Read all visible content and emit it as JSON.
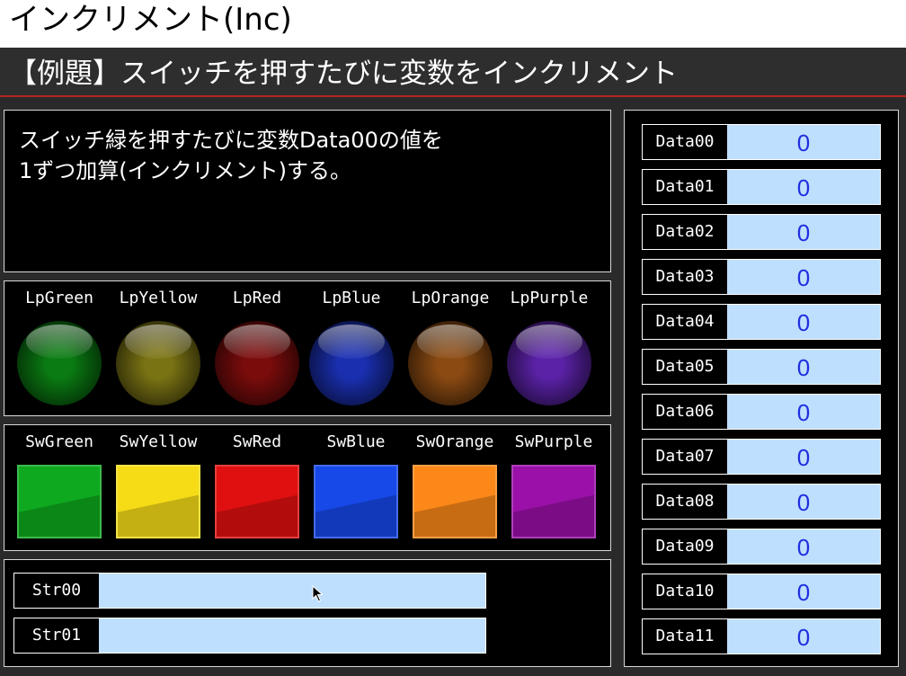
{
  "window": {
    "title": "インクリメント(Inc)"
  },
  "header": {
    "title": "【例題】スイッチを押すたびに変数をインクリメント"
  },
  "description": {
    "lines": [
      "スイッチ緑を押すたびに変数Data00の値を",
      "1ずつ加算(インクリメント)する。"
    ]
  },
  "lamps": [
    {
      "label": "LpGreen",
      "color": "#0a7a12"
    },
    {
      "label": "LpYellow",
      "color": "#7a7314"
    },
    {
      "label": "LpRed",
      "color": "#7a0c0c"
    },
    {
      "label": "LpBlue",
      "color": "#1a2fb0"
    },
    {
      "label": "LpOrange",
      "color": "#8a4a12"
    },
    {
      "label": "LpPurple",
      "color": "#5b22a8"
    }
  ],
  "switches": [
    {
      "label": "SwGreen",
      "color": "#0ea91f"
    },
    {
      "label": "SwYellow",
      "color": "#f5dc17"
    },
    {
      "label": "SwRed",
      "color": "#e01010"
    },
    {
      "label": "SwBlue",
      "color": "#1748e8"
    },
    {
      "label": "SwOrange",
      "color": "#fb8818"
    },
    {
      "label": "SwPurple",
      "color": "#9a10a8"
    }
  ],
  "strings": [
    {
      "label": "Str00",
      "value": ""
    },
    {
      "label": "Str01",
      "value": ""
    }
  ],
  "data": [
    {
      "label": "Data00",
      "value": "0"
    },
    {
      "label": "Data01",
      "value": "0"
    },
    {
      "label": "Data02",
      "value": "0"
    },
    {
      "label": "Data03",
      "value": "0"
    },
    {
      "label": "Data04",
      "value": "0"
    },
    {
      "label": "Data05",
      "value": "0"
    },
    {
      "label": "Data06",
      "value": "0"
    },
    {
      "label": "Data07",
      "value": "0"
    },
    {
      "label": "Data08",
      "value": "0"
    },
    {
      "label": "Data09",
      "value": "0"
    },
    {
      "label": "Data10",
      "value": "0"
    },
    {
      "label": "Data11",
      "value": "0"
    }
  ],
  "colors": {
    "header_bg": "#2e2e2e",
    "header_line": "#b3261e",
    "field_bg": "#bfdfff",
    "value_text": "#1f2fe0"
  }
}
